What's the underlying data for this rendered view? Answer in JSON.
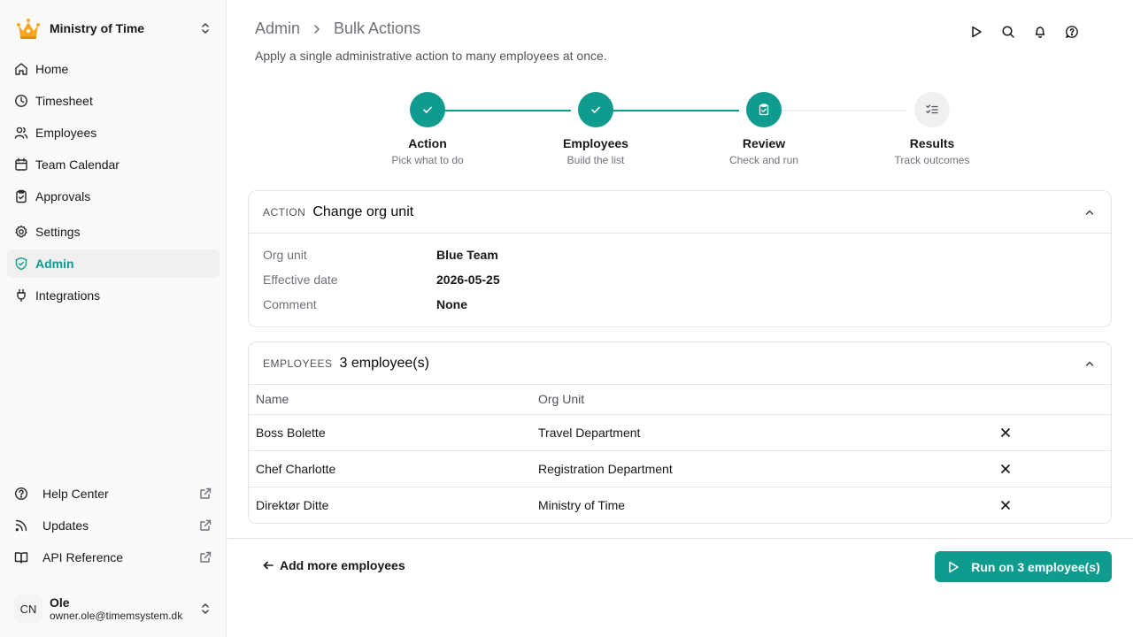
{
  "org": {
    "name": "Ministry of Time",
    "logo_icon": "crown-icon"
  },
  "nav": {
    "items": [
      {
        "label": "Home",
        "icon": "home-icon"
      },
      {
        "label": "Timesheet",
        "icon": "clock-icon"
      },
      {
        "label": "Employees",
        "icon": "users-icon"
      },
      {
        "label": "Team Calendar",
        "icon": "calendar-icon"
      },
      {
        "label": "Approvals",
        "icon": "clipboard-check-icon"
      },
      {
        "label": "Settings",
        "icon": "gear-icon"
      },
      {
        "label": "Admin",
        "icon": "shield-check-icon",
        "active": true
      },
      {
        "label": "Integrations",
        "icon": "plug-icon"
      }
    ],
    "bottom": [
      {
        "label": "Help Center",
        "icon": "help-circle-icon"
      },
      {
        "label": "Updates",
        "icon": "rss-icon"
      },
      {
        "label": "API Reference",
        "icon": "book-icon"
      }
    ]
  },
  "user": {
    "initials": "CN",
    "name": "Ole",
    "email": "owner.ole@timemsystem.dk"
  },
  "header": {
    "breadcrumb": [
      "Admin",
      "Bulk Actions"
    ],
    "subtitle": "Apply a single administrative action to many employees at once."
  },
  "steps": [
    {
      "title": "Action",
      "desc": "Pick what to do",
      "state": "done"
    },
    {
      "title": "Employees",
      "desc": "Build the list",
      "state": "done"
    },
    {
      "title": "Review",
      "desc": "Check and run",
      "state": "current"
    },
    {
      "title": "Results",
      "desc": "Track outcomes",
      "state": "todo"
    }
  ],
  "action_card": {
    "kicker": "ACTION",
    "title": "Change org unit",
    "fields": [
      {
        "key": "Org unit",
        "value": "Blue Team"
      },
      {
        "key": "Effective date",
        "value": "2026-05-25"
      },
      {
        "key": "Comment",
        "value": "None"
      }
    ]
  },
  "employees_card": {
    "kicker": "EMPLOYEES",
    "title": "3 employee(s)",
    "columns": [
      "Name",
      "Org Unit"
    ],
    "rows": [
      {
        "name": "Boss Bolette",
        "org": "Travel Department"
      },
      {
        "name": "Chef Charlotte",
        "org": "Registration Department"
      },
      {
        "name": "Direktør Ditte",
        "org": "Ministry of Time"
      }
    ]
  },
  "footer": {
    "back_label": "Add more employees",
    "run_label": "Run on 3 employee(s)"
  },
  "colors": {
    "accent": "#0f9c8f",
    "inactive_step": "#f0f0f1"
  }
}
